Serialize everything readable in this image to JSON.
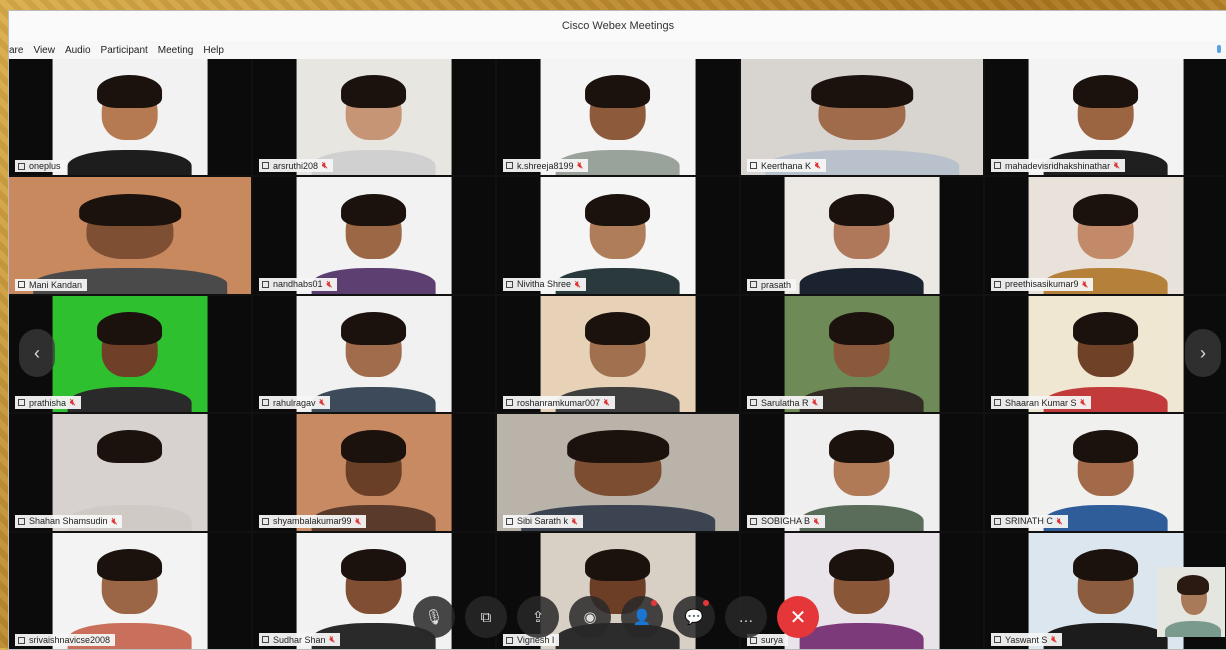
{
  "window": {
    "title": "Cisco Webex Meetings"
  },
  "menu": [
    "are",
    "View",
    "Audio",
    "Participant",
    "Meeting",
    "Help"
  ],
  "participants": [
    {
      "name": "oneplus",
      "muted": false,
      "bg": "#f2f2f2",
      "skin": "#b57a52",
      "shirt": "#1d1d1d",
      "wide": false
    },
    {
      "name": "arsruthi208",
      "muted": true,
      "bg": "#e8e6e1",
      "skin": "#c59576",
      "shirt": "#d0d0d0",
      "wide": false
    },
    {
      "name": "k.shreeja8199",
      "muted": true,
      "bg": "#f4f4f4",
      "skin": "#8d5b3b",
      "shirt": "#9aa39b",
      "wide": false
    },
    {
      "name": "Keerthana K",
      "muted": true,
      "bg": "#d8d4cf",
      "skin": "#a06b4a",
      "shirt": "#b9c2cc",
      "wide": true
    },
    {
      "name": "mahadevisridhakshinathar",
      "muted": true,
      "bg": "#f3f3f3",
      "skin": "#9b6542",
      "shirt": "#1f1f1f",
      "wide": false
    },
    {
      "name": "Mani Kandan",
      "muted": false,
      "bg": "#c9895f",
      "skin": "#7e4f33",
      "shirt": "#4a4a4a",
      "wide": true
    },
    {
      "name": "nandhabs01",
      "muted": true,
      "bg": "#f2f2f2",
      "skin": "#9c6744",
      "shirt": "#5d3f72",
      "wide": false
    },
    {
      "name": "Nivitha Shree",
      "muted": true,
      "bg": "#f5f5f5",
      "skin": "#b07d5a",
      "shirt": "#2a3a3c",
      "wide": false
    },
    {
      "name": "prasath",
      "muted": false,
      "bg": "#ece8e3",
      "skin": "#b0785a",
      "shirt": "#1c2330",
      "wide": false
    },
    {
      "name": "preethisasikumar9",
      "muted": true,
      "bg": "#e9e2da",
      "skin": "#c28a68",
      "shirt": "#b5803a",
      "wide": false
    },
    {
      "name": "prathisha",
      "muted": true,
      "bg": "#2ec02e",
      "skin": "#6f4027",
      "shirt": "#2a2a2a",
      "wide": false
    },
    {
      "name": "rahulragav",
      "muted": true,
      "bg": "#f1f1f1",
      "skin": "#a06c4c",
      "shirt": "#3c4a5a",
      "wide": false
    },
    {
      "name": "roshanramkumar007",
      "muted": true,
      "bg": "#e7d2b8",
      "skin": "#a1704e",
      "shirt": "#3f3f3f",
      "wide": false
    },
    {
      "name": "Sarulatha R",
      "muted": true,
      "bg": "#6e8a56",
      "skin": "#8a583a",
      "shirt": "#332b26",
      "wide": false
    },
    {
      "name": "Shaaran Kumar S",
      "muted": true,
      "bg": "#efe7d2",
      "skin": "#6f4126",
      "shirt": "#c23a3a",
      "wide": false
    },
    {
      "name": "Shahan Shamsudin",
      "muted": true,
      "bg": "#d7d2cf",
      "skin": "#d7d2cf",
      "shirt": "#cfcac6",
      "wide": false
    },
    {
      "name": "shyambalakumar99",
      "muted": true,
      "bg": "#c88a63",
      "skin": "#6a3f27",
      "shirt": "#5a3a2a",
      "wide": false
    },
    {
      "name": "Sibi Sarath k",
      "muted": true,
      "bg": "#b9b3aa",
      "skin": "#7c4d31",
      "shirt": "#3c4452",
      "wide": true
    },
    {
      "name": "SOBIGHA B",
      "muted": true,
      "bg": "#efefef",
      "skin": "#b07a57",
      "shirt": "#5a6d5a",
      "wide": false
    },
    {
      "name": "SRINATH C",
      "muted": true,
      "bg": "#f0f0ef",
      "skin": "#a26a48",
      "shirt": "#2f5d9a",
      "wide": false
    },
    {
      "name": "srivaishnavicse2008",
      "muted": false,
      "bg": "#f3f3f3",
      "skin": "#9b6645",
      "shirt": "#c96f5b",
      "wide": false
    },
    {
      "name": "Sudhar Shan",
      "muted": true,
      "bg": "#f2f2f2",
      "skin": "#7f4e33",
      "shirt": "#2a2a2a",
      "wide": false
    },
    {
      "name": "Vignesh I",
      "muted": false,
      "bg": "#d8d0c4",
      "skin": "#6c3e26",
      "shirt": "#2c2c2c",
      "wide": false
    },
    {
      "name": "surya",
      "muted": false,
      "bg": "#e9e4ea",
      "skin": "#8a5638",
      "shirt": "#7d3a7a",
      "wide": false
    },
    {
      "name": "Yaswant S",
      "muted": true,
      "bg": "#dbe6ef",
      "skin": "#8b5c3d",
      "shirt": "#1c1c1c",
      "wide": false
    }
  ],
  "controls": [
    {
      "id": "mute-button",
      "glyph": "🎙",
      "badge": false
    },
    {
      "id": "video-button",
      "glyph": "⧉",
      "badge": false
    },
    {
      "id": "share-button",
      "glyph": "⇪",
      "badge": false
    },
    {
      "id": "record-button",
      "glyph": "◉",
      "badge": false
    },
    {
      "id": "participants-button",
      "glyph": "👤",
      "badge": true
    },
    {
      "id": "chat-button",
      "glyph": "💬",
      "badge": true
    },
    {
      "id": "more-button",
      "glyph": "…",
      "badge": false
    },
    {
      "id": "end-meeting-button",
      "glyph": "✕",
      "badge": false
    }
  ],
  "nav": {
    "prev": "‹",
    "next": "›"
  }
}
